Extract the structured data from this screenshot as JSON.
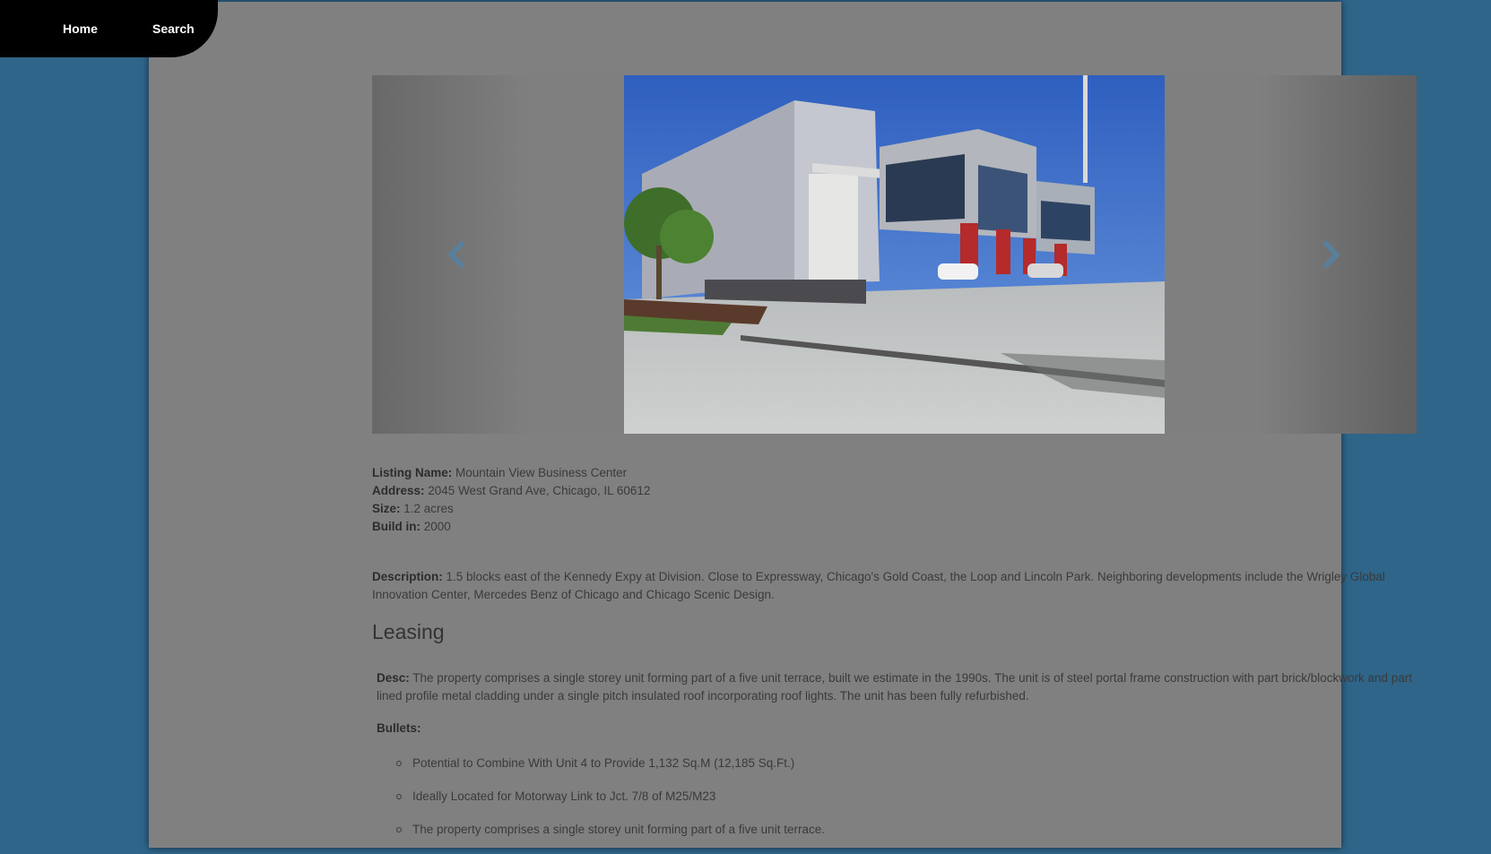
{
  "nav": {
    "home_label": "Home",
    "search_label": "Search"
  },
  "carousel": {
    "prev_icon": "chevron-left-icon",
    "next_icon": "chevron-right-icon",
    "arrow_color": "#5a7f9a"
  },
  "listing": {
    "name_label": "Listing Name:",
    "name_value": "Mountain View Business Center",
    "address_label": "Address:",
    "address_value": "2045 West Grand Ave, Chicago, IL 60612",
    "size_label": "Size:",
    "size_value": "1.2 acres",
    "build_label": "Build in:",
    "build_value": "2000",
    "description_label": "Description:",
    "description_value": "1.5 blocks east of the Kennedy Expy at Division. Close to Expressway, Chicago's Gold Coast, the Loop and Lincoln Park. Neighboring developments include the Wrigley Global Innovation Center, Mercedes Benz of Chicago and Chicago Scenic Design."
  },
  "leasing": {
    "heading": "Leasing",
    "desc_label": "Desc:",
    "desc_value": "The property comprises a single storey unit forming part of a five unit terrace, built we estimate in the 1990s. The unit is of steel portal frame construction with part brick/blockwork and part lined profile metal cladding under a single pitch insulated roof incorporating roof lights. The unit has been fully refurbished.",
    "bullets_label": "Bullets:",
    "bullets": [
      "Potential to Combine With Unit 4 to Provide 1,132 Sq.M (12,185 Sq.Ft.)",
      "Ideally Located for Motorway Link to Jct. 7/8 of M25/M23",
      "The property comprises a single storey unit forming part of a five unit terrace."
    ]
  }
}
